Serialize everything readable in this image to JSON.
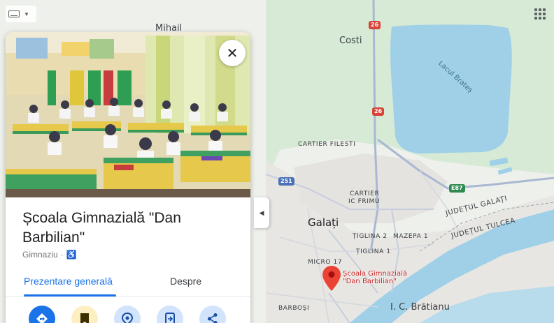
{
  "map": {
    "labels": {
      "mihail": "Mihail",
      "costi": "Costi",
      "lacul_brates": "Lacul Brateș",
      "cartier_filesti": "CARTIER FILESTI",
      "cartier_ic_frimu_line1": "CARTIER",
      "cartier_ic_frimu_line2": "IC FRIMU",
      "galati": "Galați",
      "tiglina_2": "ȚIGLINA 2",
      "mazepa_1": "MAZEPA 1",
      "tiglina_1": "ȚIGLINA 1",
      "micro_17": "MICRO 17",
      "barbosi": "BARBOȘI",
      "ic_bratianu": "I. C. Brătianu",
      "judetul_galati": "JUDEȚUL GALAȚI",
      "judetul_tulcea": "JUDEȚUL TULCEA"
    },
    "shields": {
      "r26_top": "26",
      "r26_mid": "26",
      "r251": "251",
      "e87": "E87"
    },
    "pin": {
      "label_line1": "Școala Gimnazială",
      "label_line2": "\"Dan Barbilian\"",
      "color": "#ea4335"
    },
    "colors": {
      "water": "#9fd0e8",
      "land": "#eef0ec",
      "urban": "#e8e6e3",
      "green": "#cfe7cf",
      "road": "#a9b8d2"
    }
  },
  "controls": {
    "keyboard_icon": "keyboard-icon",
    "apps_icon": "apps-grid-icon",
    "collapse_icon": "chevron-left-icon",
    "collapse_glyph": "◀"
  },
  "place": {
    "close_glyph": "✕",
    "title": "Școala Gimnazială \"Dan Barbilian\"",
    "category": "Gimnaziu",
    "separator": "·",
    "accessibility_glyph": "♿",
    "tabs": [
      {
        "label": "Prezentare generală",
        "active": true
      },
      {
        "label": "Despre",
        "active": false
      }
    ],
    "actions": [
      {
        "icon": "directions-icon",
        "color": "#1a73e8"
      },
      {
        "icon": "save-bookmark-icon",
        "color": "#fbbc04"
      },
      {
        "icon": "nearby-icon",
        "color": "#1a73e8"
      },
      {
        "icon": "send-to-phone-icon",
        "color": "#1a73e8"
      },
      {
        "icon": "share-icon",
        "color": "#1a73e8"
      }
    ]
  }
}
